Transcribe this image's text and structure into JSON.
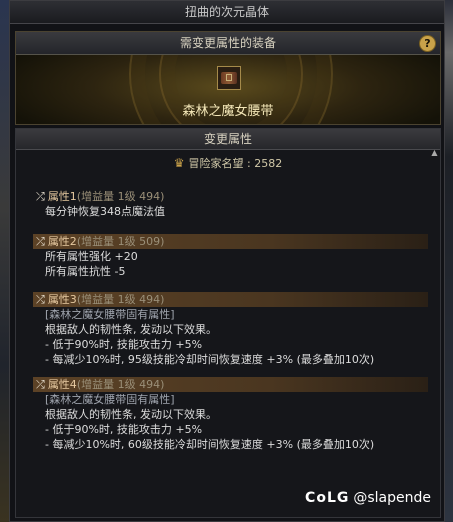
{
  "window": {
    "title": "扭曲的次元晶体"
  },
  "equip": {
    "header": "需变更属性的装备",
    "help": "?",
    "item_icon": "belt-icon",
    "item_name": "森林之魔女腰带"
  },
  "change": {
    "header": "变更属性",
    "fame_label": "冒险家名望 : 2582"
  },
  "attributes": [
    {
      "name": "属性1",
      "grade": "(增益量 1级 494)",
      "lines": [
        "每分钟恢复348点魔法值"
      ]
    },
    {
      "name": "属性2",
      "grade": "(增益量 1级 509)",
      "lines": [
        "所有属性强化 +20",
        "所有属性抗性 -5"
      ]
    },
    {
      "name": "属性3",
      "grade": "(增益量 1级 494)",
      "fixed": "[森林之魔女腰带固有属性]",
      "lines": [
        "根据敌人的韧性条, 发动以下效果。",
        "- 低于90%时, 技能攻击力 +5%",
        "- 每减少10%时, 95级技能冷却时间恢复速度 +3% (最多叠加10次)"
      ]
    },
    {
      "name": "属性4",
      "grade": "(增益量 1级 494)",
      "fixed": "[森林之魔女腰带固有属性]",
      "lines": [
        "根据敌人的韧性条, 发动以下效果。",
        "- 低于90%时, 技能攻击力 +5%",
        "- 每减少10%时, 60级技能冷却时间恢复速度 +3% (最多叠加10次)"
      ]
    }
  ],
  "watermark": {
    "logo": "CoLG",
    "handle": "@slapende"
  }
}
